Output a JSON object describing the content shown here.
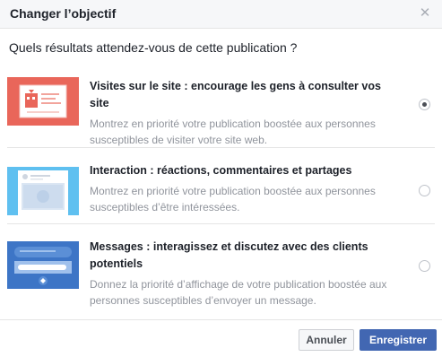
{
  "dialog": {
    "title": "Changer l’objectif",
    "close_icon": "close-icon"
  },
  "question": "Quels résultats attendez-vous de cette publication ?",
  "options": [
    {
      "title": "Visites sur le site : encourage les gens à consulter vos site",
      "description": "Montrez en priorité votre publication boostée aux personnes susceptibles de visiter votre site web.",
      "selected": true,
      "thumb_color": "#e9665a"
    },
    {
      "title": "Interaction : réactions, commentaires et partages",
      "description": "Montrez en priorité votre publication boostée aux personnes susceptibles d’être intéressées.",
      "selected": false,
      "thumb_color": "#5fc0f0"
    },
    {
      "title": "Messages : interagissez et discutez avec des clients potentiels",
      "description": "Donnez la priorité d’affichage de votre publication boostée aux personnes susceptibles d’envoyer un message.",
      "selected": false,
      "thumb_color": "#3d75c6"
    }
  ],
  "footer": {
    "cancel_label": "Annuler",
    "save_label": "Enregistrer"
  }
}
